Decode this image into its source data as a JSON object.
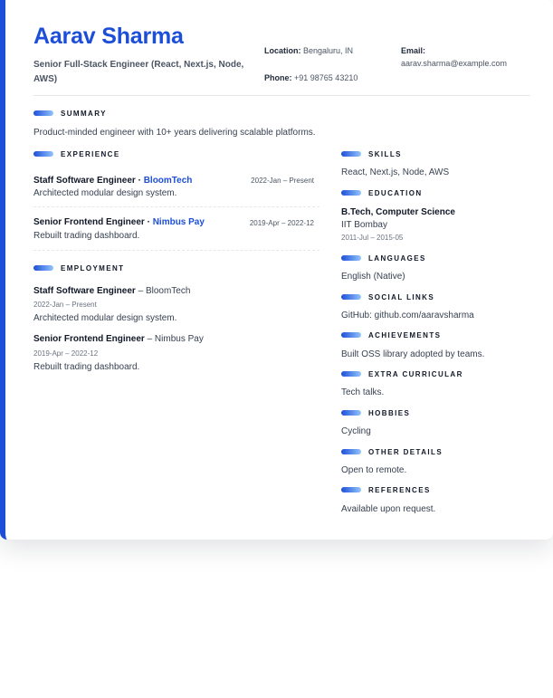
{
  "header": {
    "name": "Aarav Sharma",
    "title": "Senior Full-Stack Engineer (React, Next.js, Node, AWS)",
    "location_label": "Location:",
    "location": "Bengaluru, IN",
    "phone_label": "Phone:",
    "phone": "+91 98765 43210",
    "email_label": "Email:",
    "email": "aarav.sharma@example.com"
  },
  "summary": {
    "heading": "SUMMARY",
    "text": "Product-minded engineer with 10+ years delivering scalable platforms."
  },
  "experience": {
    "heading": "EXPERIENCE",
    "items": [
      {
        "role": "Staff Software Engineer",
        "sep": " · ",
        "company": "BloomTech",
        "dates": "2022-Jan – Present",
        "desc": "Architected modular design system."
      },
      {
        "role": "Senior Frontend Engineer",
        "sep": " · ",
        "company": "Nimbus Pay",
        "dates": "2019-Apr – 2022-12",
        "desc": "Rebuilt trading dashboard."
      }
    ]
  },
  "employment": {
    "heading": "EMPLOYMENT",
    "items": [
      {
        "role": "Staff Software Engineer",
        "sep": " – ",
        "company": "BloomTech",
        "dates": "2022-Jan – Present",
        "desc": "Architected modular design system."
      },
      {
        "role": "Senior Frontend Engineer",
        "sep": " – ",
        "company": "Nimbus Pay",
        "dates": "2019-Apr – 2022-12",
        "desc": "Rebuilt trading dashboard."
      }
    ]
  },
  "skills": {
    "heading": "SKILLS",
    "text": "React, Next.js, Node, AWS"
  },
  "education": {
    "heading": "EDUCATION",
    "degree": "B.Tech, Computer Science",
    "school": "IIT Bombay",
    "dates": "2011-Jul – 2015-05"
  },
  "languages": {
    "heading": "LANGUAGES",
    "text": "English (Native)"
  },
  "social": {
    "heading": "SOCIAL LINKS",
    "text": "GitHub: github.com/aaravsharma"
  },
  "achievements": {
    "heading": "ACHIEVEMENTS",
    "text": "Built OSS library adopted by teams."
  },
  "extra": {
    "heading": "EXTRA CURRICULAR",
    "text": "Tech talks."
  },
  "hobbies": {
    "heading": "HOBBIES",
    "text": "Cycling"
  },
  "other": {
    "heading": "OTHER DETAILS",
    "text": "Open to remote."
  },
  "references": {
    "heading": "REFERENCES",
    "text": "Available upon request."
  },
  "colors": {
    "accent": "#1d4ed8",
    "accent_light": "#93c5fd",
    "text": "#1f2937",
    "muted": "#6b7280"
  }
}
